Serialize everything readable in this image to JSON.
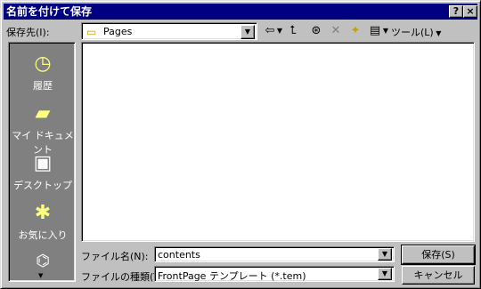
{
  "window": {
    "title": "名前を付けて保存",
    "help_btn": "?",
    "close_btn": "×"
  },
  "save_in": {
    "label": "保存先(I):",
    "value": "Pages"
  },
  "toolbar": {
    "tools_label": "ツール(L)"
  },
  "places": [
    {
      "label": "履歴",
      "icon": "history-icon"
    },
    {
      "label": "マイ ドキュメント",
      "icon": "my-documents-icon"
    },
    {
      "label": "デスクトップ",
      "icon": "desktop-icon"
    },
    {
      "label": "お気に入り",
      "icon": "favorites-icon"
    }
  ],
  "filename": {
    "label": "ファイル名(N):",
    "value": "contents"
  },
  "filetype": {
    "label": "ファイルの種類(T):",
    "value": "FrontPage テンプレート (*.tem)"
  },
  "buttons": {
    "save": "保存(S)",
    "cancel": "キャンセル"
  }
}
